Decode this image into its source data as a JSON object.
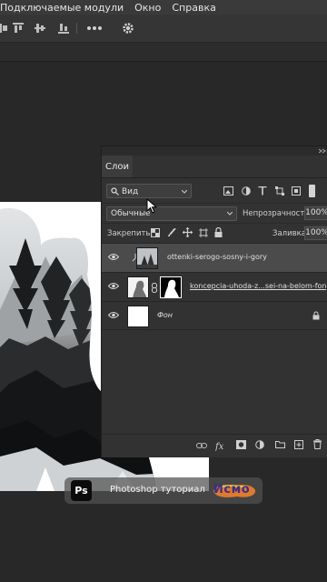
{
  "menubar": {
    "items": [
      "Подключаемые модули",
      "Окно",
      "Справка"
    ]
  },
  "layers_panel": {
    "tab_label": "Слои",
    "filter_label": "Вид",
    "blend_mode": "Обычные",
    "opacity_label": "Непрозрачность:",
    "opacity_value": "100%",
    "lock_label": "Закрепить:",
    "fill_label": "Заливка:",
    "fill_value": "100%",
    "layers": [
      {
        "name": "ottenki-serogo-sosny-i-gory",
        "visible": true,
        "selected": true
      },
      {
        "name": "koncepcia-uhoda-z...sei-na-belom-fone",
        "visible": true,
        "selected": false
      },
      {
        "name": "Фон",
        "visible": true,
        "selected": false,
        "locked": true
      }
    ],
    "bottom_icons": [
      "link-icon",
      "fx-icon",
      "mask-icon",
      "adjustment-icon",
      "group-icon",
      "new-layer-icon",
      "delete-icon"
    ]
  },
  "watermark": {
    "logo_text": "Ps",
    "text": "Photoshop туториал",
    "brand": "Исмо"
  },
  "colors": {
    "menubar_bg": "#3a3a3a",
    "panel_bg": "#323232",
    "selected_layer_bg": "#4b4b4b",
    "workspace_bg": "#282828"
  }
}
